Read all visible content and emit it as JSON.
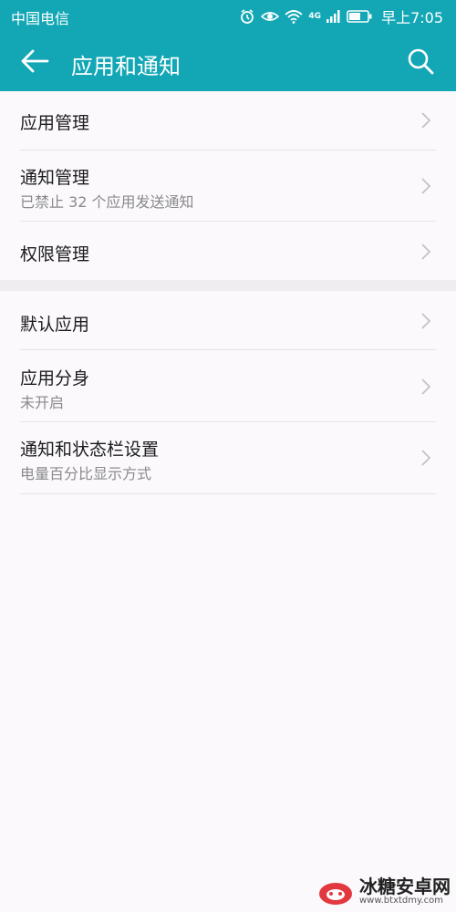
{
  "status": {
    "carrier": "中国电信",
    "time": "早上7:05",
    "network": "4G",
    "icons": [
      "alarm-icon",
      "eye-icon",
      "wifi-icon",
      "signal-icon",
      "battery-icon"
    ]
  },
  "appbar": {
    "title": "应用和通知",
    "back_icon": "arrow-left-icon",
    "search_icon": "search-icon",
    "color": "#13a7b6"
  },
  "groups": [
    {
      "items": [
        {
          "title": "应用管理",
          "subtitle": ""
        },
        {
          "title": "通知管理",
          "subtitle": "已禁止 32 个应用发送通知"
        },
        {
          "title": "权限管理",
          "subtitle": ""
        }
      ]
    },
    {
      "items": [
        {
          "title": "默认应用",
          "subtitle": ""
        },
        {
          "title": "应用分身",
          "subtitle": "未开启"
        },
        {
          "title": "通知和状态栏设置",
          "subtitle": "电量百分比显示方式"
        }
      ]
    }
  ],
  "watermark": {
    "name": "冰糖安卓网",
    "url": "www.btxtdmy.com"
  }
}
